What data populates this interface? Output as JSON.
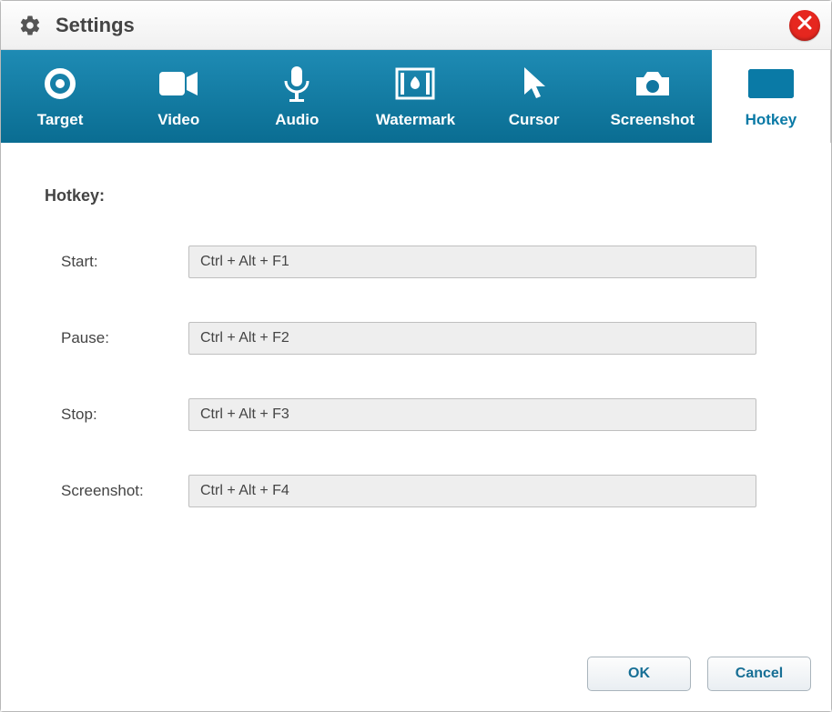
{
  "window": {
    "title": "Settings"
  },
  "tabs": {
    "target": "Target",
    "video": "Video",
    "audio": "Audio",
    "watermark": "Watermark",
    "cursor": "Cursor",
    "screenshot": "Screenshot",
    "hotkey": "Hotkey",
    "active": "hotkey"
  },
  "section": {
    "heading": "Hotkey:"
  },
  "hotkeys": {
    "start": {
      "label": "Start:",
      "value": "Ctrl + Alt + F1"
    },
    "pause": {
      "label": "Pause:",
      "value": "Ctrl + Alt + F2"
    },
    "stop": {
      "label": "Stop:",
      "value": "Ctrl + Alt + F3"
    },
    "screenshot": {
      "label": "Screenshot:",
      "value": "Ctrl + Alt + F4"
    }
  },
  "buttons": {
    "ok": "OK",
    "cancel": "Cancel"
  }
}
